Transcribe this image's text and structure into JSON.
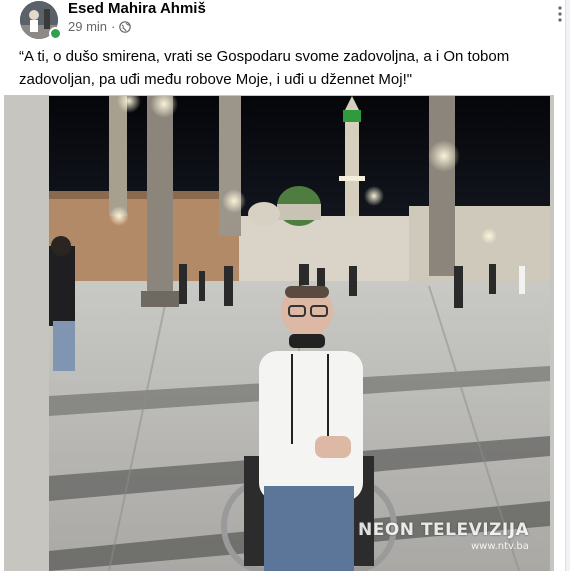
{
  "post": {
    "author": "Esed Mahira Ahmiš",
    "time": "29 min",
    "separator": "·",
    "more_icon": "more-dots-icon",
    "privacy_icon": "globe-icon",
    "text": "“A ti, o dušo smirena, vrati se Gospodaru svome zadovoljna, a i On tobom zadovoljan, pa uđi među robove Moje, i uđi u džennet Moj!\""
  },
  "photo": {
    "watermark": "NEON TELEVIZIJA",
    "watermark_url": "www.ntv.ba"
  },
  "colors": {
    "author": "#050505",
    "meta": "#65676b",
    "online": "#31a24c",
    "frame": "#c7c5c0"
  }
}
